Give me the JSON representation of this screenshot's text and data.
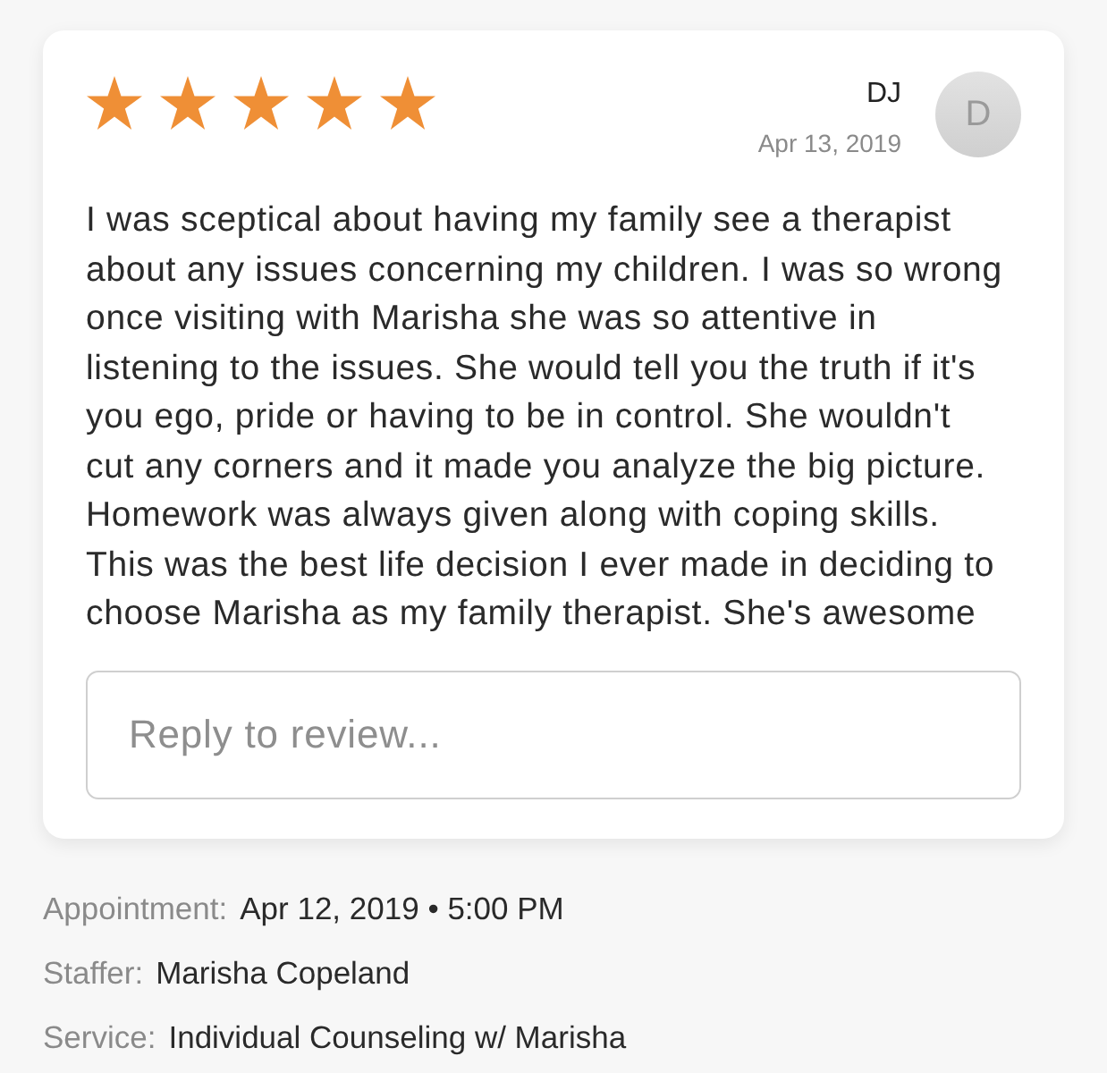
{
  "review": {
    "stars": 5,
    "author": "DJ",
    "date": "Apr 13, 2019",
    "avatar_initial": "D",
    "text": "I was sceptical about having my family see a therapist about any issues concerning my children. I was so wrong once visiting with Marisha she was so attentive in listening to the issues. She would tell you the truth if it's you ego, pride or having to be in control. She wouldn't cut any corners and it made you analyze the big picture. Homework was always given along with coping skills. This was the best life decision I ever made in deciding to choose Marisha as my family therapist. She's awesome",
    "reply": {
      "placeholder": "Reply to review..."
    }
  },
  "details": [
    {
      "label": "Appointment:",
      "value": "Apr 12, 2019 • 5:00 PM"
    },
    {
      "label": "Staffer:",
      "value": "Marisha Copeland"
    },
    {
      "label": "Service:",
      "value": "Individual Counseling w/ Marisha"
    }
  ]
}
